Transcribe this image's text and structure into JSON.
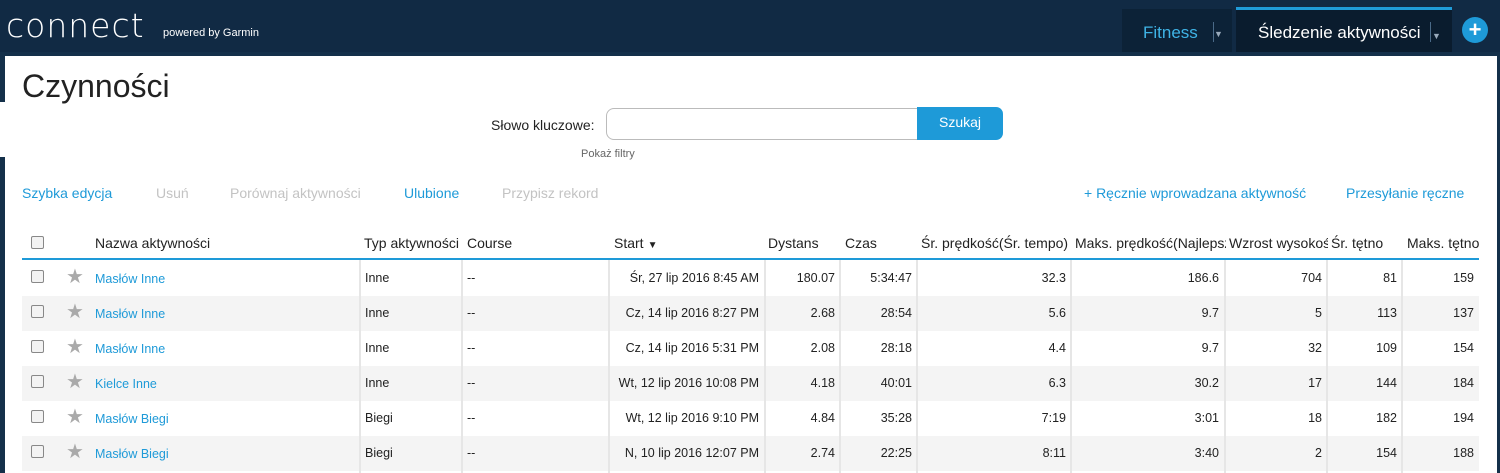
{
  "header": {
    "logo": "connect",
    "powered": "powered by Garmin",
    "nav_fitness": "Fitness",
    "nav_tracking": "Śledzenie aktywności",
    "add": "+"
  },
  "page": {
    "title": "Czynności",
    "search_label": "Słowo kluczowe:",
    "search_button": "Szukaj",
    "search_value": "",
    "show_filters": "Pokaż filtry"
  },
  "actions": {
    "quick_edit": "Szybka edycja",
    "delete": "Usuń",
    "compare": "Porównaj aktywności",
    "favorites": "Ulubione",
    "assign_record": "Przypisz rekord",
    "manual_activity": "+ Ręcznie wprowadzana aktywność",
    "manual_upload": "Przesyłanie ręczne"
  },
  "table": {
    "headers": [
      "Nazwa aktywności",
      "Typ aktywności",
      "Course",
      "Start",
      "Dystans",
      "Czas",
      "Śr. prędkość(Śr. tempo)",
      "Maks. prędkość(Najlepsze tempo)",
      "Wzrost wysokości",
      "Śr. tętno",
      "Maks. tętno"
    ],
    "rows": [
      [
        "Masłów Inne",
        "Inne",
        "--",
        "Śr, 27 lip 2016 8:45 AM",
        "180.07",
        "5:34:47",
        "32.3",
        "186.6",
        "704",
        "81",
        "159"
      ],
      [
        "Masłów Inne",
        "Inne",
        "--",
        "Cz, 14 lip 2016 8:27 PM",
        "2.68",
        "28:54",
        "5.6",
        "9.7",
        "5",
        "113",
        "137"
      ],
      [
        "Masłów Inne",
        "Inne",
        "--",
        "Cz, 14 lip 2016 5:31 PM",
        "2.08",
        "28:18",
        "4.4",
        "9.7",
        "32",
        "109",
        "154"
      ],
      [
        "Kielce Inne",
        "Inne",
        "--",
        "Wt, 12 lip 2016 10:08 PM",
        "4.18",
        "40:01",
        "6.3",
        "30.2",
        "17",
        "144",
        "184"
      ],
      [
        "Masłów Biegi",
        "Biegi",
        "--",
        "Wt, 12 lip 2016 9:10 PM",
        "4.84",
        "35:28",
        "7:19",
        "3:01",
        "18",
        "182",
        "194"
      ],
      [
        "Masłów Biegi",
        "Biegi",
        "--",
        "N, 10 lip 2016 12:07 PM",
        "2.74",
        "22:25",
        "8:11",
        "3:40",
        "2",
        "154",
        "188"
      ]
    ]
  },
  "colors": {
    "accent": "#1e9ad8",
    "topbar": "#112a44"
  }
}
